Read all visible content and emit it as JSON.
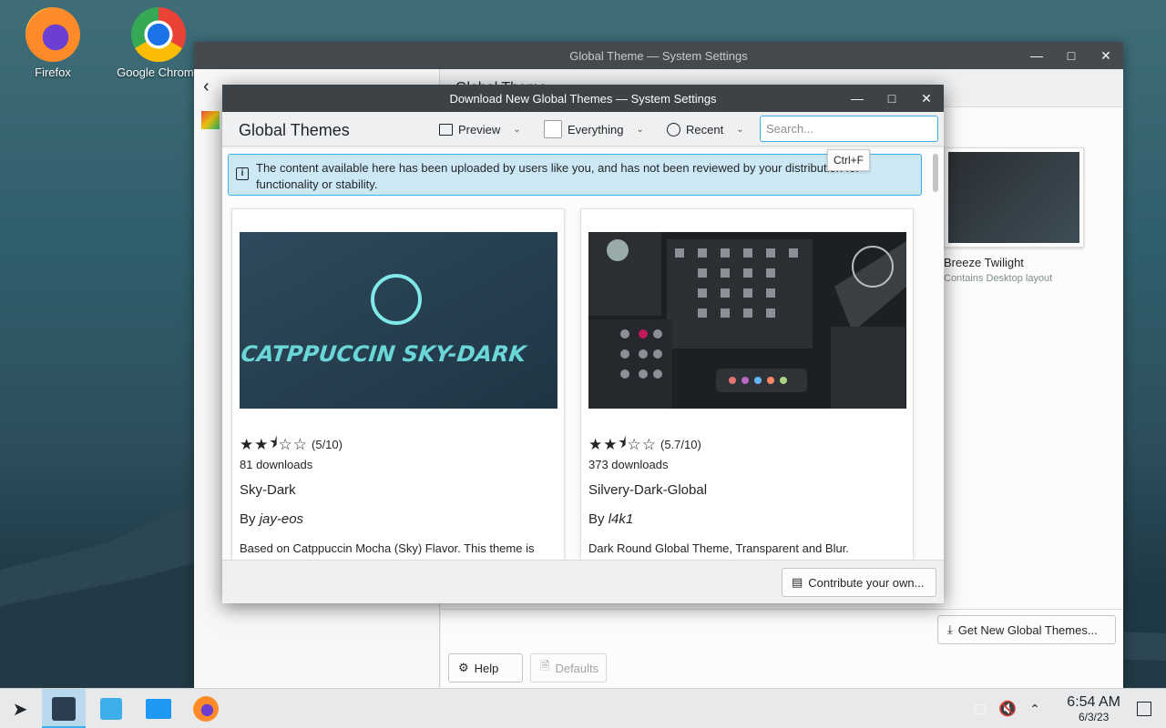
{
  "desktop": {
    "icons": [
      {
        "label": "Firefox"
      },
      {
        "label": "Google Chrome"
      }
    ]
  },
  "back_window": {
    "title": "Global Theme — System Settings",
    "header": "Global Theme",
    "theme_card": {
      "name": "Breeze Twilight",
      "subtitle": "Contains Desktop layout"
    },
    "get_new_label": "Get New Global Themes...",
    "help_label": "Help",
    "defaults_label": "Defaults"
  },
  "dialog": {
    "title": "Download New Global Themes — System Settings",
    "heading": "Global Themes",
    "toolbar": {
      "preview_label": "Preview",
      "filter_label": "Everything",
      "sort_label": "Recent",
      "search_placeholder": "Search..."
    },
    "tooltip": "Ctrl+F",
    "notice": "The content available here has been uploaded by users like you, and has not been reviewed by your distribution for functionality or stability.",
    "items": [
      {
        "thumb_text": "CATPPUCCIN SKY-DARK",
        "rating": "(5/10)",
        "rating_value": 0.5,
        "downloads": "81 downloads",
        "name": "Sky-Dark",
        "by": "By",
        "author": "jay-eos",
        "description": "Based on Catppuccin Mocha (Sky) Flavor. This theme is"
      },
      {
        "rating": "(5.7/10)",
        "rating_value": 0.57,
        "downloads": "373 downloads",
        "name": "Silvery-Dark-Global",
        "by": "By",
        "author": "l4k1",
        "description": "Dark Round Global Theme, Transparent and Blur."
      }
    ],
    "contribute_label": "Contribute your own..."
  },
  "taskbar": {
    "time": "6:54 AM",
    "date": "6/3/23"
  },
  "colors": {
    "accent": "#3daee9",
    "notice_bg": "#cde8f5",
    "titlebar": "#454a4f"
  }
}
